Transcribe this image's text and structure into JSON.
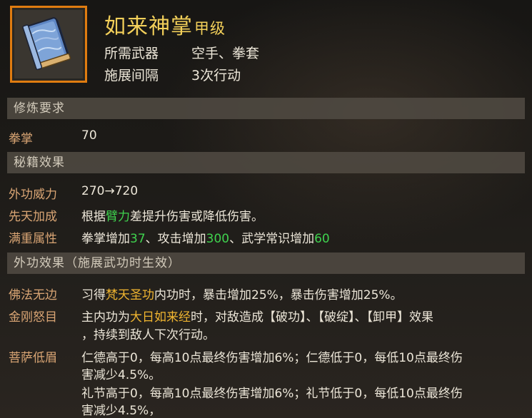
{
  "skill": {
    "name": "如来神掌",
    "grade": "甲级",
    "icon": "blue-scroll-book-icon",
    "weapon_label": "所需武器",
    "weapon_value": "空手、拳套",
    "interval_label": "施展间隔",
    "interval_value": "3次行动"
  },
  "requirements": {
    "title": "修炼要求",
    "stat_label": "拳掌",
    "stat_value": "70"
  },
  "effects": {
    "title": "秘籍效果",
    "power_label": "外功威力",
    "power_value": "270→720",
    "innate_label": "先天加成",
    "innate_pre": "根据",
    "innate_highlight": "臂力",
    "innate_post": "差提升伤害或降低伤害。",
    "full_label": "满重属性",
    "full_p1": "拳掌增加",
    "full_v1": "37",
    "full_p2": "、攻击增加",
    "full_v2": "300",
    "full_p3": "、武学常识增加",
    "full_v3": "60"
  },
  "ext_effects": {
    "title": "外功效果（施展武功时生效）",
    "items": [
      {
        "label": "佛法无边",
        "pre": "习得",
        "highlight": "梵天圣功",
        "post": "内功时，暴击增加25%，暴击伤害增加25%。"
      },
      {
        "label": "金刚怒目",
        "pre": "主内功为",
        "highlight": "大日如来经",
        "post": "时，对敌造成【破功】、【破绽】、【卸甲】效果",
        "line2": "，持续到敌人下次行动。"
      },
      {
        "label": "菩萨低眉",
        "line1": "仁德高于0，每高10点最终伤害增加6%；仁德低于0，每低10点最终伤",
        "line2": "害减少4.5%。",
        "line3": "礼节高于0，每高10点最终伤害增加6%；礼节低于0，每低10点最终伤",
        "line4": "害减少4.5%，"
      }
    ]
  },
  "colors": {
    "title_gold": "#f3d05a",
    "label_orange": "#d9a574",
    "value_green": "#3fd24e",
    "highlight_gold": "#f0b530",
    "frame_orange": "#e07c10"
  }
}
